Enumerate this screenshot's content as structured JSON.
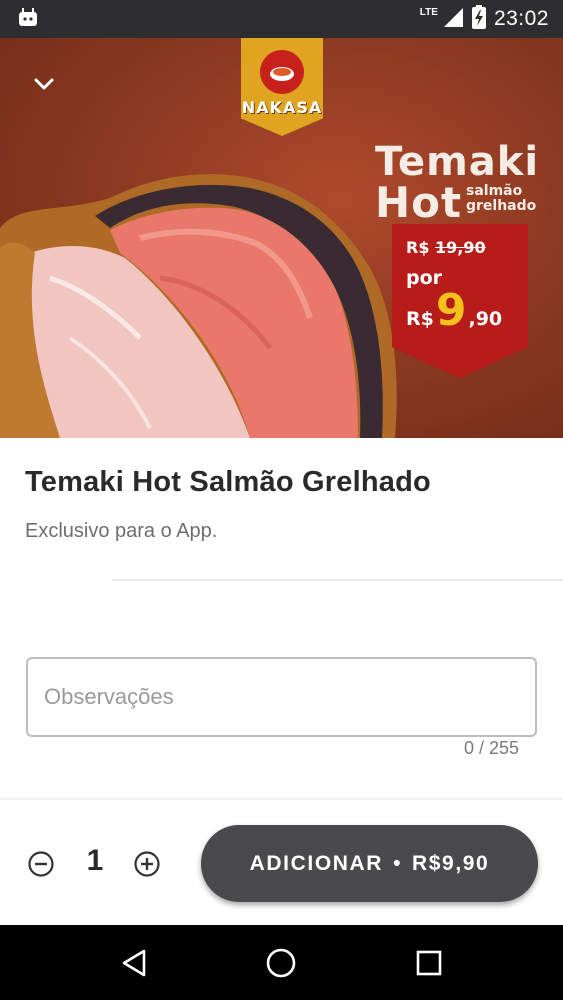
{
  "status_bar": {
    "time": "23:02",
    "network": "LTE",
    "icons": [
      "android-notification-icon",
      "signal-icon",
      "battery-charging-icon"
    ]
  },
  "hero": {
    "brand": "NAKASA",
    "promo_line1": "Temaki",
    "promo_line2": "Hot",
    "promo_sub1": "salmão",
    "promo_sub2": "grelhado",
    "old_price_currency": "R$",
    "old_price": "19,90",
    "price_por": "por",
    "new_price_currency": "R$",
    "new_price_integer": "9",
    "new_price_cents": ",90"
  },
  "product": {
    "title": "Temaki Hot Salmão Grelhado",
    "description": "Exclusivo para o App."
  },
  "observations": {
    "placeholder": "Observações",
    "value": "",
    "counter": "0 / 255"
  },
  "cart": {
    "quantity": "1",
    "add_label": "ADICIONAR",
    "separator": "•",
    "total": "R$9,90"
  },
  "colors": {
    "button_bg": "#4a4a4d",
    "hero_bg": "#8e3a22",
    "price_tag": "#b81c1a",
    "price_highlight": "#f4c21a",
    "logo_banner": "#e0a520"
  }
}
